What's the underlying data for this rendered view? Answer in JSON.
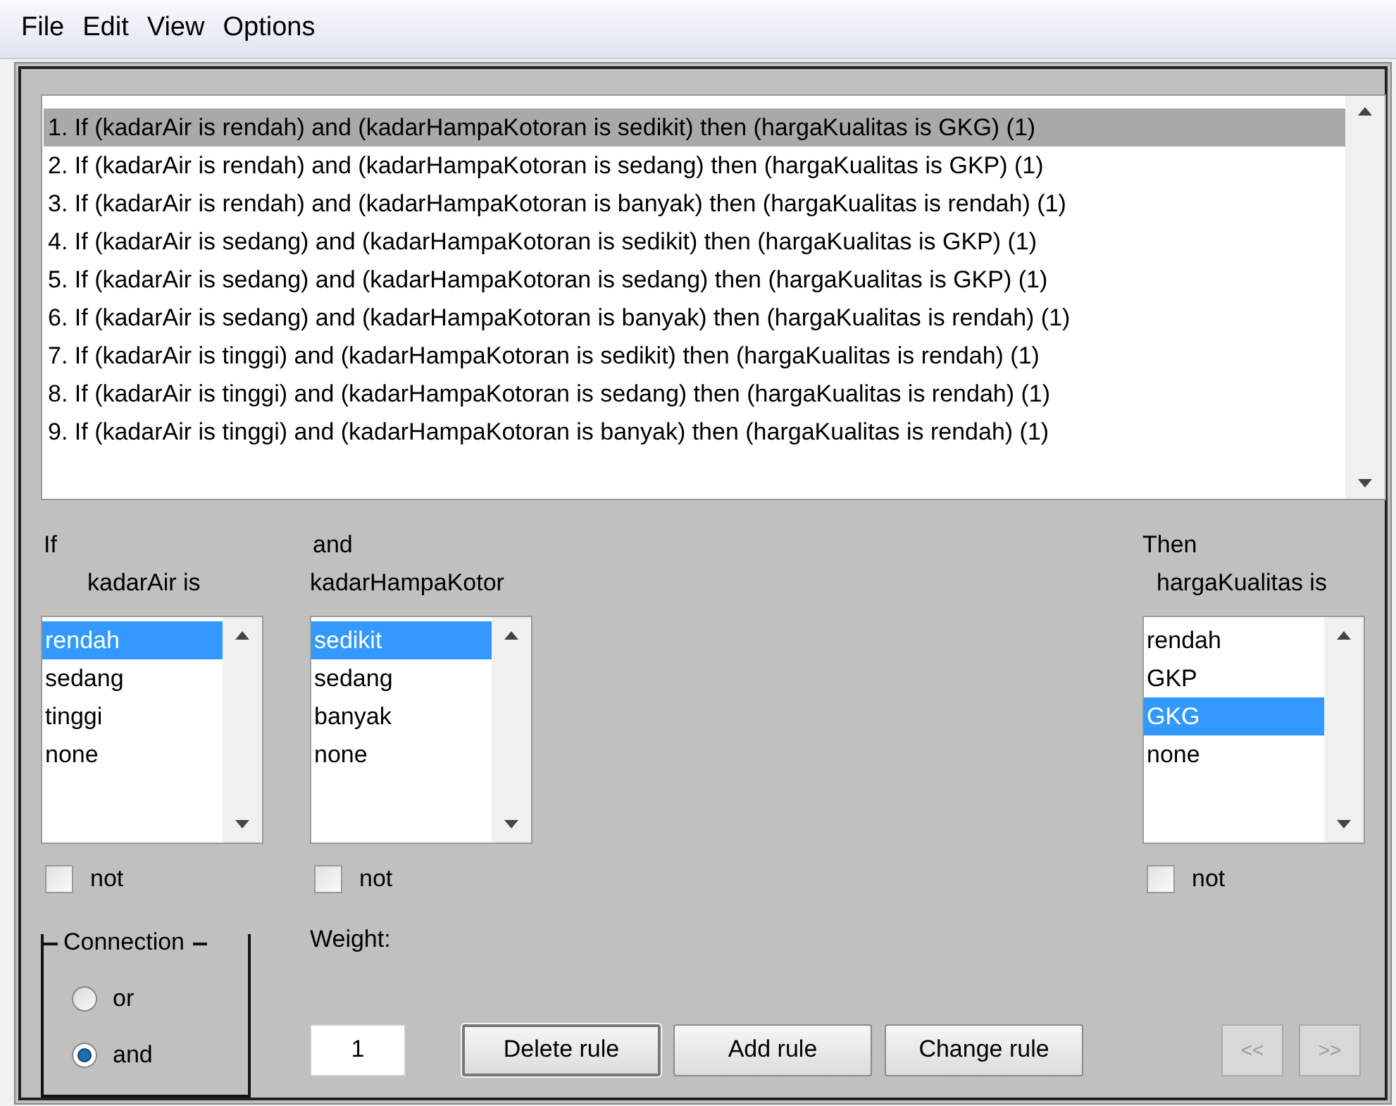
{
  "menu": [
    "File",
    "Edit",
    "View",
    "Options"
  ],
  "rules": [
    {
      "text": "1. If (kadarAir is rendah) and (kadarHampaKotoran is sedikit) then (hargaKualitas is GKG) (1)",
      "selected": true
    },
    {
      "text": "2. If (kadarAir is rendah) and (kadarHampaKotoran is sedang) then (hargaKualitas is GKP) (1)",
      "selected": false
    },
    {
      "text": "3. If (kadarAir is rendah) and (kadarHampaKotoran is banyak) then (hargaKualitas is rendah) (1)",
      "selected": false
    },
    {
      "text": "4. If (kadarAir is sedang) and (kadarHampaKotoran is sedikit) then (hargaKualitas is GKP) (1)",
      "selected": false
    },
    {
      "text": "5. If (kadarAir is sedang) and (kadarHampaKotoran is sedang) then (hargaKualitas is GKP) (1)",
      "selected": false
    },
    {
      "text": "6. If (kadarAir is sedang) and (kadarHampaKotoran is banyak) then (hargaKualitas is rendah) (1)",
      "selected": false
    },
    {
      "text": "7. If (kadarAir is tinggi) and (kadarHampaKotoran is sedikit) then (hargaKualitas is rendah) (1)",
      "selected": false
    },
    {
      "text": "8. If (kadarAir is tinggi) and (kadarHampaKotoran is sedang) then (hargaKualitas is rendah) (1)",
      "selected": false
    },
    {
      "text": "9. If (kadarAir is tinggi) and (kadarHampaKotoran is banyak) then (hargaKualitas is rendah) (1)",
      "selected": false
    }
  ],
  "columns": [
    {
      "kind": "input",
      "heading": "If",
      "variable": "kadarAir is",
      "items": [
        {
          "label": "rendah",
          "selected": true
        },
        {
          "label": "sedang",
          "selected": false
        },
        {
          "label": "tinggi",
          "selected": false
        },
        {
          "label": "none",
          "selected": false
        }
      ],
      "not_label": "not",
      "not_checked": false
    },
    {
      "kind": "input",
      "heading": "and",
      "variable": "kadarHampaKotor",
      "items": [
        {
          "label": "sedikit",
          "selected": true
        },
        {
          "label": "sedang",
          "selected": false
        },
        {
          "label": "banyak",
          "selected": false
        },
        {
          "label": "none",
          "selected": false
        }
      ],
      "not_label": "not",
      "not_checked": false
    },
    {
      "kind": "output",
      "heading": "Then",
      "variable": "hargaKualitas is",
      "items": [
        {
          "label": "rendah",
          "selected": false
        },
        {
          "label": "GKP",
          "selected": false
        },
        {
          "label": "GKG",
          "selected": true
        },
        {
          "label": "none",
          "selected": false
        }
      ],
      "not_label": "not",
      "not_checked": false
    }
  ],
  "connection": {
    "title": "Connection",
    "options": [
      {
        "label": "or",
        "selected": false
      },
      {
        "label": "and",
        "selected": true
      }
    ]
  },
  "weight": {
    "label": "Weight:",
    "value": "1"
  },
  "buttons": [
    {
      "label": "Delete rule",
      "focused": true
    },
    {
      "label": "Add rule",
      "focused": false
    },
    {
      "label": "Change rule",
      "focused": false
    }
  ],
  "nav_buttons": [
    {
      "label": "<<",
      "disabled": true
    },
    {
      "label": ">>",
      "disabled": true
    }
  ]
}
